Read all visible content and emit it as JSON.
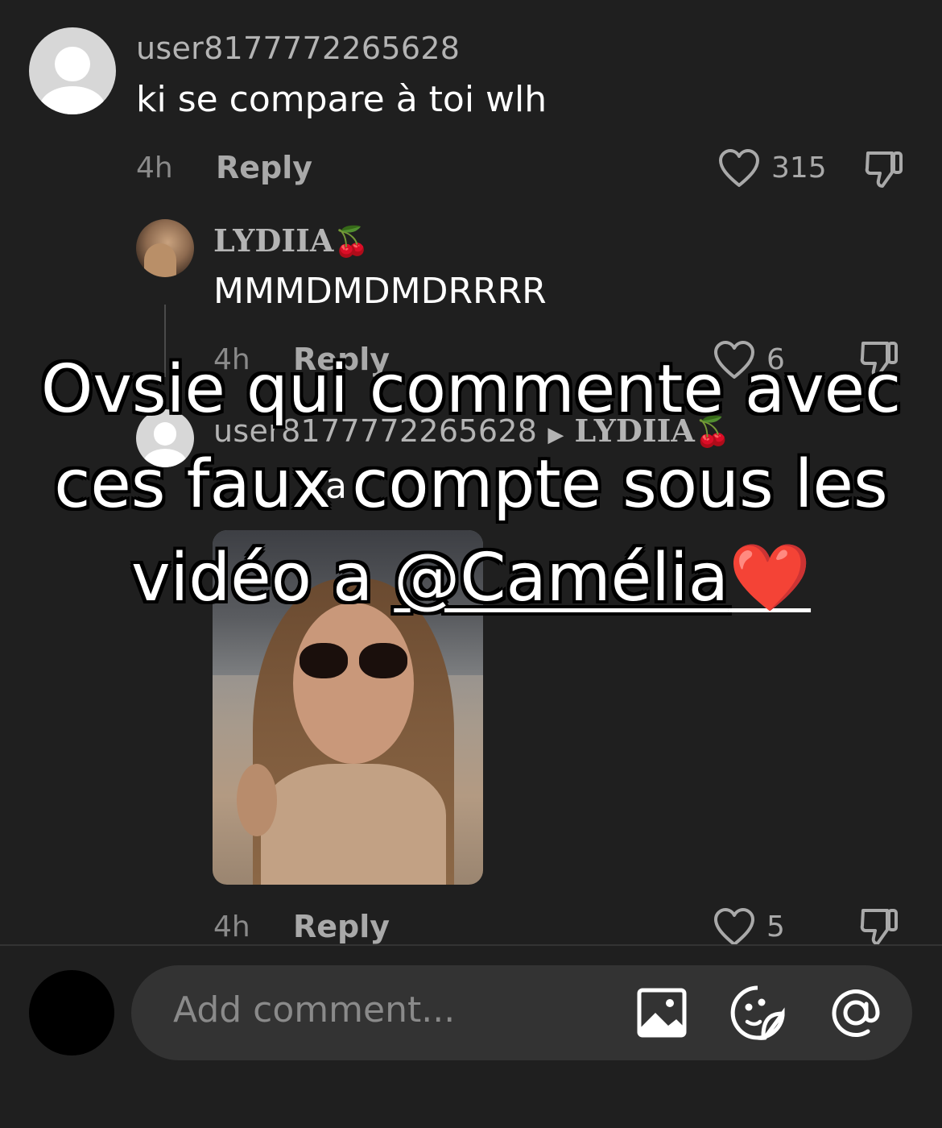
{
  "comments": [
    {
      "username": "user8177772265628",
      "text": "ki se compare à toi wlh",
      "time": "4h",
      "reply_label": "Reply",
      "likes": "315"
    },
    {
      "username": "LYDIIA",
      "username_emoji": "🍒",
      "text": "MMMDMDMDRRRR",
      "time": "4h",
      "reply_label": "Reply",
      "likes": "6"
    },
    {
      "username": "user8177772265628",
      "reply_to": "LYDIIA",
      "reply_to_emoji": "🍒",
      "text": "a",
      "time": "4h",
      "reply_label": "Reply",
      "likes": "5"
    }
  ],
  "overlay": {
    "line1": "Ovsie qui commente avec",
    "line2": "ces faux compte sous les",
    "line3_prefix": "vidéo a ",
    "mention": "@Camélia",
    "heart": "❤️"
  },
  "composer": {
    "placeholder": "Add comment..."
  },
  "icons": [
    "heart-outline-icon",
    "dislike-icon",
    "image-icon",
    "sticker-icon",
    "at-icon",
    "default-avatar-icon"
  ],
  "colors": {
    "background": "#1f1f1f",
    "input_background": "#333333",
    "muted_text": "#a9a9a9"
  }
}
